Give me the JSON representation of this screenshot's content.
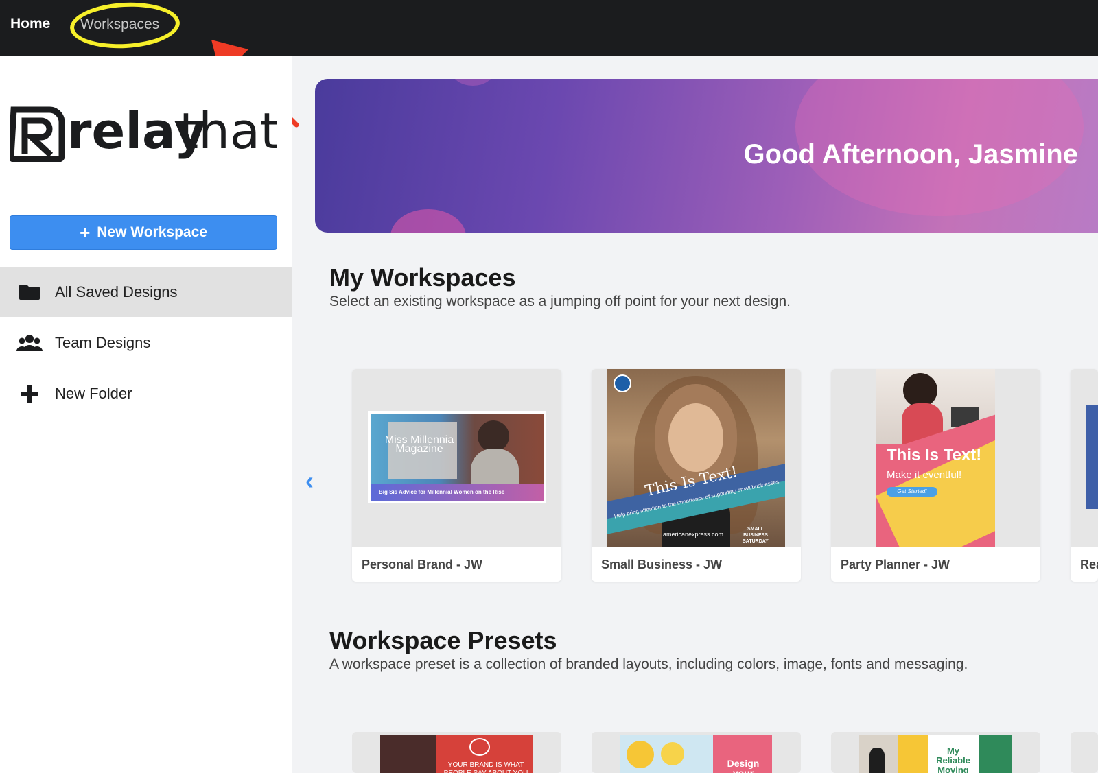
{
  "topnav": {
    "home": "Home",
    "workspaces": "Workspaces"
  },
  "sidebar": {
    "new_workspace": "New Workspace",
    "items": [
      {
        "label": "All Saved Designs",
        "icon": "folder-icon"
      },
      {
        "label": "Team Designs",
        "icon": "users-icon"
      },
      {
        "label": "New Folder",
        "icon": "plus-icon"
      }
    ]
  },
  "hero": {
    "greeting": "Good Afternoon, Jasmine"
  },
  "my_workspaces": {
    "title": "My Workspaces",
    "subtitle": "Select an existing workspace as a jumping off point for your next design.",
    "cards": [
      {
        "name": "Personal Brand - JW",
        "thumb_title": "Miss Millennia Magazine",
        "thumb_sub": "Big Sis Advice for Millennial Women on the Rise"
      },
      {
        "name": "Small Business - JW",
        "thumb_title": "This Is Text!",
        "thumb_sub": "Help bring attention to the importance of supporting small businesses.",
        "thumb_footer": "americanexpress.com",
        "thumb_badge": "SMALL BUSINESS SATURDAY"
      },
      {
        "name": "Party Planner - JW",
        "thumb_title": "This Is Text!",
        "thumb_sub": "Make it eventful!",
        "thumb_cta": "Get Started!"
      },
      {
        "name": "Rea"
      }
    ]
  },
  "presets": {
    "title": "Workspace Presets",
    "subtitle": "A workspace preset is a collection of branded layouts, including colors, image, fonts and messaging.",
    "cards": [
      {
        "text": "YOUR BRAND IS WHAT PEOPLE SAY ABOUT YOU"
      },
      {
        "text": "Design your perfect"
      },
      {
        "text": "My Reliable Moving"
      }
    ]
  },
  "colors": {
    "topbar": "#1b1c1e",
    "accent": "#3d8ef0",
    "annotation_circle": "#f7f02a",
    "annotation_arrow": "#ee3b25"
  }
}
